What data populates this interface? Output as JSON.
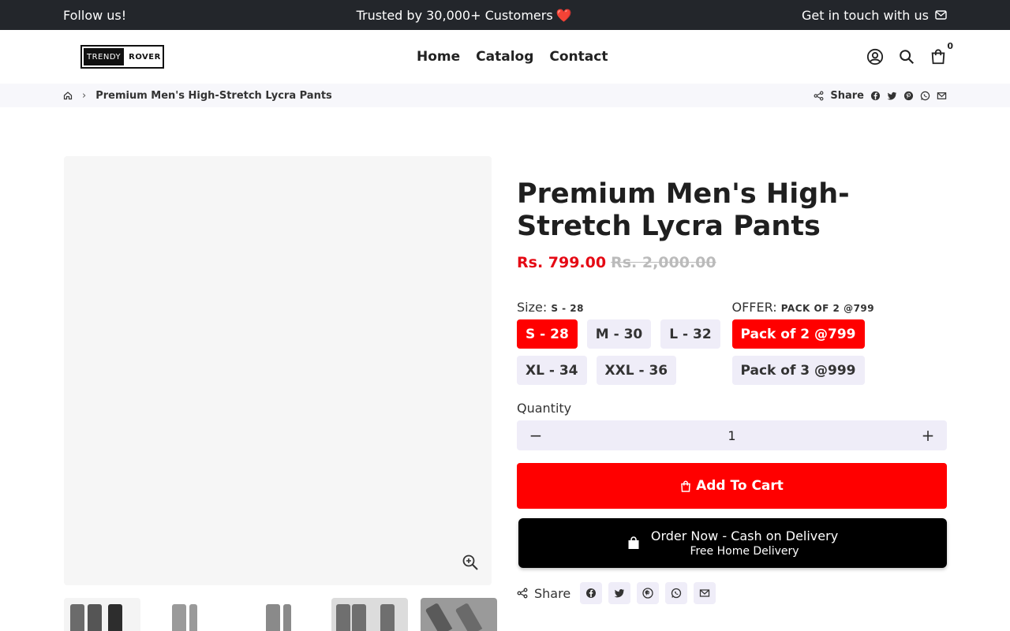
{
  "topbar": {
    "left": "Follow us!",
    "center": "Trusted by 30,000+ Customers",
    "center_icon": "heart-icon",
    "right": "Get in touch with us",
    "right_icon": "mail-icon"
  },
  "logo": {
    "part1": "TRENDY",
    "part2": "ROVER"
  },
  "nav": {
    "home": "Home",
    "catalog": "Catalog",
    "contact": "Contact"
  },
  "cart": {
    "count": "0"
  },
  "breadcrumb": {
    "current": "Premium Men's High-Stretch Lycra Pants",
    "share": "Share"
  },
  "product": {
    "title": "Premium Men's High-Stretch Lycra Pants",
    "price": "Rs. 799.00",
    "compare_price": "Rs. 2,000.00",
    "size": {
      "label": "Size:",
      "selected": "S - 28",
      "options": [
        "S - 28",
        "M - 30",
        "L - 32",
        "XL - 34",
        "XXL - 36"
      ]
    },
    "offer": {
      "label": "OFFER:",
      "selected": "PACK OF 2 @799",
      "options": [
        "Pack of 2 @799",
        "Pack of 3 @999"
      ]
    },
    "quantity": {
      "label": "Quantity",
      "value": "1"
    },
    "add_to_cart": "Add To Cart",
    "order_now": {
      "line1": "Order Now - Cash on Delivery",
      "line2": "Free Home Delivery"
    },
    "share": "Share"
  },
  "colors": {
    "accent": "#ff0000",
    "topbar": "#23262b",
    "chip": "#efedf8"
  }
}
